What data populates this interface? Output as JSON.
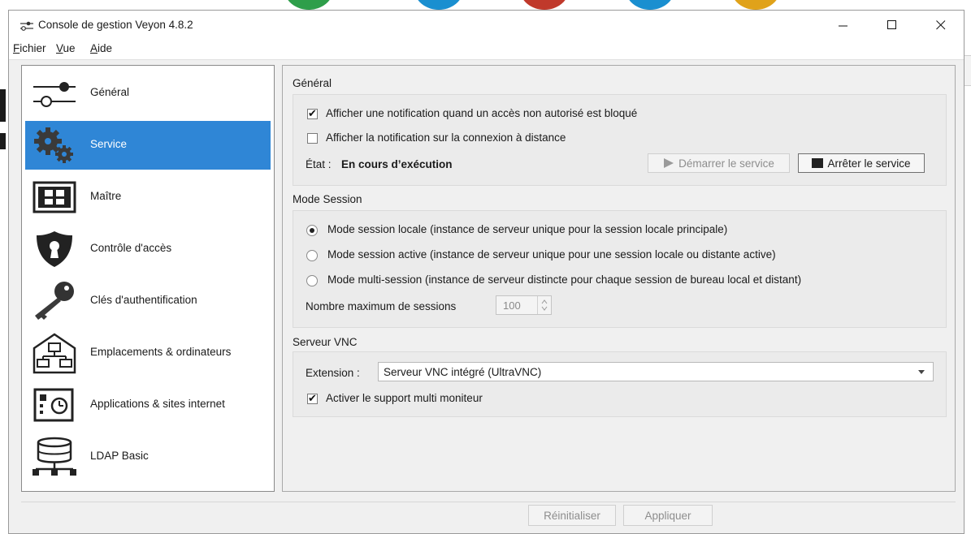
{
  "window": {
    "title": "Console de gestion Veyon 4.8.2"
  },
  "menu": [
    {
      "u": "F",
      "rest": "ichier"
    },
    {
      "u": "V",
      "rest": "ue"
    },
    {
      "u": "A",
      "rest": "ide"
    }
  ],
  "sidebar": {
    "items": [
      {
        "label": "Général",
        "icon": "slider-settings-icon"
      },
      {
        "label": "Service",
        "icon": "gears-icon",
        "active": true
      },
      {
        "label": "Maître",
        "icon": "grid-window-icon"
      },
      {
        "label": "Contrôle d'accès",
        "icon": "shield-keyhole-icon"
      },
      {
        "label": "Clés d'authentification",
        "icon": "key-icon"
      },
      {
        "label": "Emplacements & ordinateurs",
        "icon": "house-computers-icon"
      },
      {
        "label": "Applications & sites internet",
        "icon": "window-clock-icon"
      },
      {
        "label": "LDAP Basic",
        "icon": "database-network-icon"
      }
    ]
  },
  "general": {
    "title": "Général",
    "notify_unauthorized": "Afficher une notification quand un accès non autorisé est bloqué",
    "notify_unauthorized_checked": true,
    "notify_remote": "Afficher la notification sur la connexion à distance",
    "notify_remote_checked": false,
    "state_label": "État :",
    "state_value": "En cours d’exécution",
    "start_button": "Démarrer le service",
    "stop_button": "Arrêter le service"
  },
  "session": {
    "title": "Mode Session",
    "options": [
      "Mode session locale (instance de serveur unique pour la session locale principale)",
      "Mode session active (instance de serveur unique pour une session locale ou distante active)",
      "Mode multi-session (instance de serveur distincte pour chaque session de bureau local et distant)"
    ],
    "selected_index": 0,
    "max_sessions_label": "Nombre maximum de sessions",
    "max_sessions_value": "100"
  },
  "vnc": {
    "title": "Serveur VNC",
    "extension_label": "Extension :",
    "extension_value": "Serveur VNC intégré (UltraVNC)",
    "multi_monitor": "Activer le support multi moniteur",
    "multi_monitor_checked": true
  },
  "footer": {
    "reset": "Réinitialiser",
    "apply": "Appliquer"
  },
  "colors": {
    "accent": "#2f86d6"
  }
}
